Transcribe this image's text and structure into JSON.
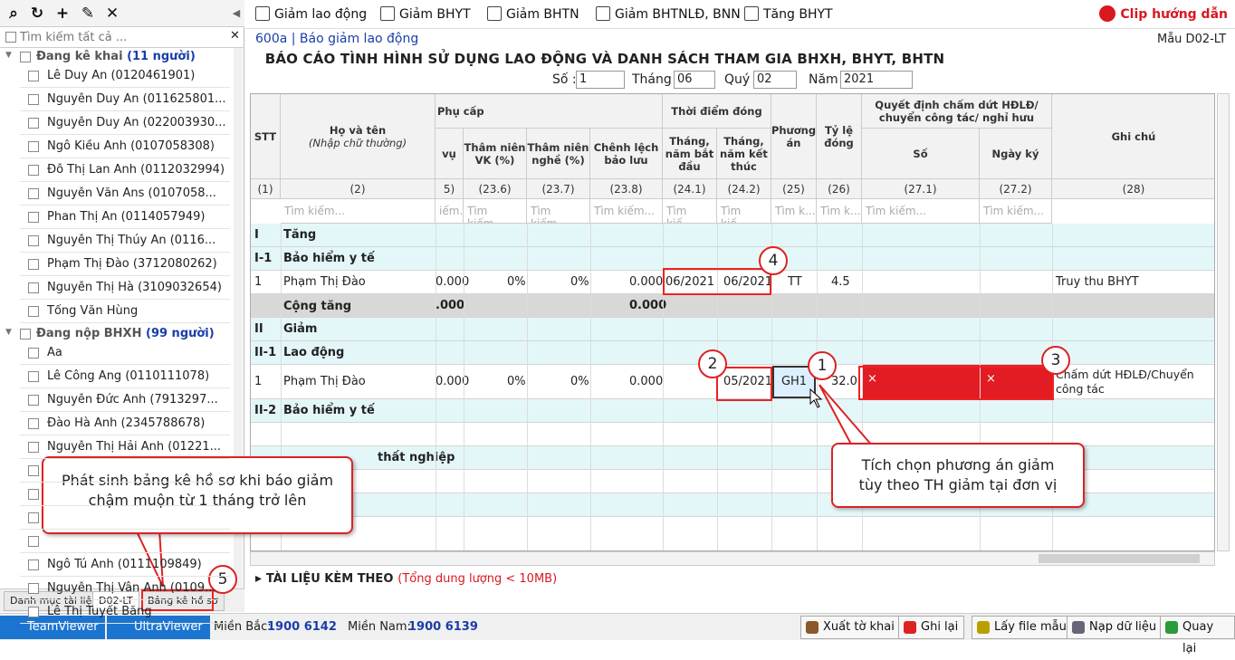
{
  "left_toolbar": {
    "icons": [
      "search-icon",
      "refresh-icon",
      "add-icon",
      "edit-icon",
      "close-icon"
    ]
  },
  "left_search": {
    "placeholder": "Tìm kiếm tất cả ...",
    "clear": "✕"
  },
  "groups": [
    {
      "name": "Đang kê khai",
      "count": "(11 người)",
      "items": [
        "Lê Duy An (0120461901)",
        "Nguyễn Duy An (011625801...",
        "Nguyễn Duy An (022003930...",
        "Ngô Kiều Anh (0107058308)",
        "Đỗ Thị Lan Anh (0112032994)",
        "Nguyễn Văn Ans (0107058...",
        "Phan Thị An (0114057949)",
        "Nguyễn Thị Thúy An (0116...",
        "Phạm Thị Đào (3712080262)",
        "Nguyễn Thị Hà (3109032654)",
        "Tống Văn Hùng"
      ]
    },
    {
      "name": "Đang nộp BHXH",
      "count": "(99 người)",
      "items": [
        "Aa",
        "Lê Công Áng (0110111078)",
        "Nguyễn Đức Anh (7913297...",
        "Đào Hà Anh (2345788678)",
        "Nguyễn Thị Hải Anh (01221...",
        "",
        "",
        "",
        "",
        "Ngô Tú Anh (0111109849)",
        "Nguyễn Thị Vân Anh (0109...",
        "Lê Thị Tuyết Băng"
      ]
    }
  ],
  "bottom_tabs": [
    "Danh mục tài liệu",
    "D02-LT",
    "Bảng kê hồ sơ"
  ],
  "statusbar": {
    "teamviewer": "TeamViewer",
    "ultraviewer": "UltraViewer",
    "mb_label": "Miền Bắc:",
    "mb_phone": "1900 6142",
    "mn_label": "Miền Nam:",
    "mn_phone": "1900 6139",
    "buttons": [
      "Xuất tờ khai",
      "Ghi lại",
      "Lấy file mẫu",
      "Nạp dữ liệu",
      "Quay lại"
    ]
  },
  "toolbar": {
    "items": [
      "Giảm lao động",
      "Giảm BHYT",
      "Giảm BHTN",
      "Giảm BHTNLĐ, BNN",
      "Tăng BHYT"
    ],
    "clip": "Clip hướng dẫn"
  },
  "report": {
    "code": "600a | Báo giảm lao động",
    "form": "Mẫu D02-LT",
    "title": "BÁO CÁO TÌNH HÌNH SỬ DỤNG LAO ĐỘNG VÀ DANH SÁCH THAM GIA BHXH, BHYT, BHTN",
    "so_label": "Số :",
    "so": "1",
    "thang_label": "Tháng",
    "thang": "06",
    "quy_label": "Quý",
    "quy": "02",
    "nam_label": "Năm",
    "nam": "2021"
  },
  "grid": {
    "headers": {
      "stt": "STT",
      "name": "Họ và tên",
      "name_sub": "(Nhập chữ thường)",
      "phucap": "Phụ cấp",
      "vu": "vụ",
      "tnvk": "Thâm niên VK (%)",
      "tnn": "Thâm niên nghề (%)",
      "clbl": "Chênh lệch bảo lưu",
      "tdd": "Thời điểm đóng",
      "bd": "Tháng, năm bắt đầu",
      "kt": "Tháng, năm kết thúc",
      "pa": "Phương án",
      "tl": "Tỷ lệ đóng",
      "qd": "Quyết định chấm dứt HĐLĐ/ chuyển công tác/ nghỉ hưu",
      "so": "Số",
      "nk": "Ngày ký",
      "gc": "Ghi chú"
    },
    "nums": [
      "(1)",
      "(2)",
      "5)",
      "(23.6)",
      "(23.7)",
      "(23.8)",
      "(24.1)",
      "(24.2)",
      "(25)",
      "(26)",
      "(27.1)",
      "(27.2)",
      "(28)"
    ],
    "search": [
      "Tìm kiếm...",
      "iếm...",
      "Tìm kiếm...",
      "Tìm kiếm...",
      "Tìm kiếm...",
      "Tìm kiế...",
      "Tìm kiế...",
      "Tìm k...",
      "Tìm k...",
      "Tìm kiếm...",
      "Tìm kiếm..."
    ],
    "rows": {
      "r_i": [
        "I",
        "Tăng"
      ],
      "r_i1": [
        "I-1",
        "Bảo hiểm y tế"
      ],
      "r_d1": {
        "stt": "1",
        "name": "Phạm Thị Đào",
        "vu": "0.000",
        "tnvk": "0%",
        "tnn": "0%",
        "clbl": "0.000",
        "bd": "06/2021",
        "kt": "06/2021",
        "pa": "TT",
        "tl": "4.5",
        "gc": "Truy thu BHYT"
      },
      "r_ct": {
        "label": "Cộng tăng",
        "vu": ".000",
        "clbl": "0.000"
      },
      "r_ii": [
        "II",
        "Giảm"
      ],
      "r_ii1": [
        "II-1",
        "Lao động"
      ],
      "r_d2": {
        "stt": "1",
        "name": "Phạm Thị Đào",
        "vu": "0.000",
        "tnvk": "0%",
        "tnn": "0%",
        "clbl": "0.000",
        "kt": "05/2021",
        "pa": "GH1",
        "tl": "32.0",
        "x1": "×",
        "x2": "×",
        "gc": "Chấm dứt HĐLĐ/Chuyển công tác"
      },
      "r_ii2": [
        "II-2",
        "Bảo hiểm y tế"
      ],
      "r_ii3": "thất nghiệp"
    }
  },
  "attach": {
    "label": "TÀI LIỆU KÈM THEO",
    "size": "(Tổng dung lượng < 10MB)"
  },
  "callouts": {
    "c1": "1",
    "c2": "2",
    "c3": "3",
    "c4": "4",
    "c5": "5",
    "note_left": "Phát sinh bảng kê hồ sơ khi báo giảm chậm muộn từ 1 tháng trở lên",
    "note_right": "Tích chọn phương án giảm tùy theo TH giảm tại đơn vị"
  },
  "colors": {
    "accent_red": "#d9181f",
    "row_cyan": "#e3f7f9",
    "link_blue": "#1a3ea8"
  }
}
